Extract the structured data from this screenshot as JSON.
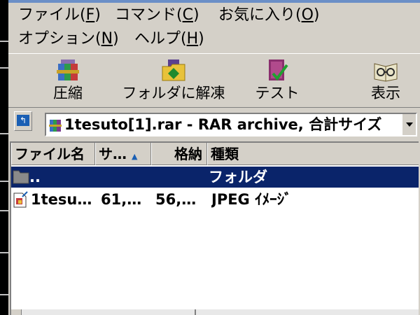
{
  "menu": {
    "file": "ファイル(F)",
    "command": "コマンド(C)",
    "favorites": "お気に入り(O)",
    "options": "オプション(N)",
    "help": "ヘルプ(H)"
  },
  "toolbar": {
    "compress": "圧縮",
    "extract_to_folder": "フォルダに解凍",
    "test": "テスト",
    "view": "表示"
  },
  "address": {
    "path": "1tesuto[1].rar - RAR archive, 合計サイズ"
  },
  "columns": {
    "name": "ファイル名",
    "size": "サ…",
    "packed": "格納",
    "type": "種類"
  },
  "rows": [
    {
      "name": "..",
      "size": "",
      "packed": "",
      "type": "フォルダ",
      "icon": "folder-icon",
      "selected": true
    },
    {
      "name": "1tesu…",
      "size": "61,…",
      "packed": "56,…",
      "type": "JPEG ｲﾒｰｼﾞ",
      "icon": "jpeg-file-icon",
      "selected": false
    }
  ],
  "colors": {
    "selection": "#0a246a",
    "window": "#d4d0c8"
  }
}
